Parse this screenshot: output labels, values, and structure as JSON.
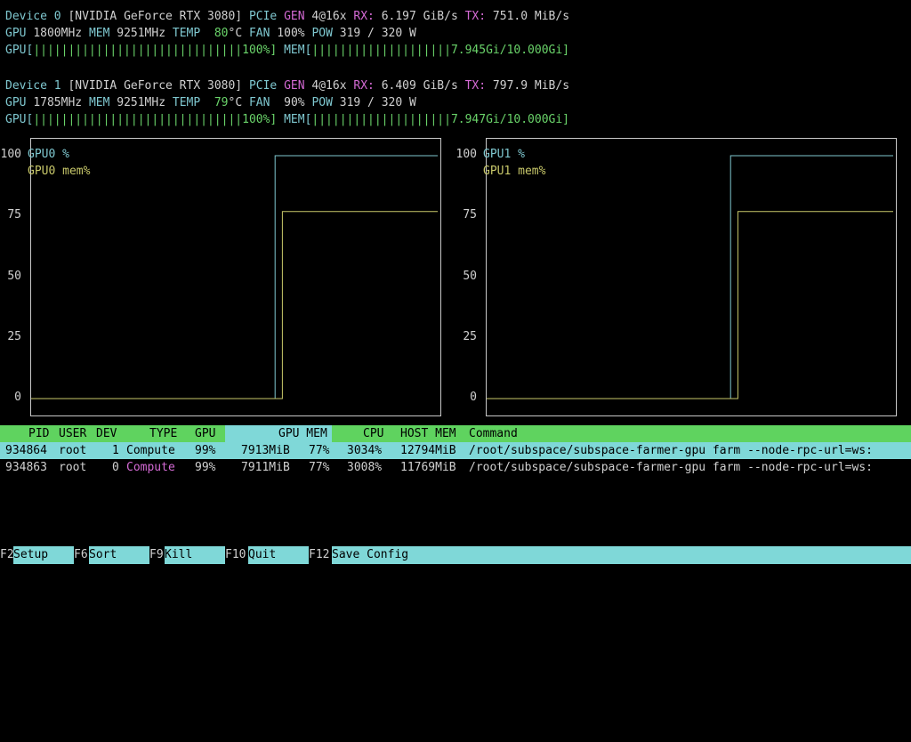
{
  "devices": [
    {
      "line1": {
        "device_label": "Device 0",
        "name": "[NVIDIA GeForce RTX 3080]",
        "pcie_label": "PCIe",
        "gen_label": "GEN",
        "gen_value": "4@16x",
        "rx_label": "RX:",
        "rx_value": "6.197 GiB/s",
        "tx_label": "TX:",
        "tx_value": "751.0 MiB/s"
      },
      "line2": {
        "gpu_label": "GPU",
        "gpu_clock": "1800MHz",
        "mem_label": "MEM",
        "mem_clock": "9251MHz",
        "temp_label": "TEMP",
        "temp_value": "80",
        "temp_unit": "°C",
        "fan_label": "FAN",
        "fan_value": "100%",
        "pow_label": "POW",
        "pow_value": "319 / 320 W"
      },
      "line3": {
        "gpu_bar_label": "GPU[",
        "gpu_bar_fill": "||||||||||||||||||||||||||||||",
        "gpu_bar_value": "100%]",
        "mem_bar_label": "MEM[",
        "mem_bar_fill": "||||||||||||||||||||",
        "mem_bar_value": "7.945Gi/10.000Gi]"
      }
    },
    {
      "line1": {
        "device_label": "Device 1",
        "name": "[NVIDIA GeForce RTX 3080]",
        "pcie_label": "PCIe",
        "gen_label": "GEN",
        "gen_value": "4@16x",
        "rx_label": "RX:",
        "rx_value": "6.409 GiB/s",
        "tx_label": "TX:",
        "tx_value": "797.9 MiB/s"
      },
      "line2": {
        "gpu_label": "GPU",
        "gpu_clock": "1785MHz",
        "mem_label": "MEM",
        "mem_clock": "9251MHz",
        "temp_label": "TEMP",
        "temp_value": "79",
        "temp_unit": "°C",
        "fan_label": "FAN",
        "fan_value": " 90%",
        "pow_label": "POW",
        "pow_value": "319 / 320 W"
      },
      "line3": {
        "gpu_bar_label": "GPU[",
        "gpu_bar_fill": "||||||||||||||||||||||||||||||",
        "gpu_bar_value": "100%]",
        "mem_bar_label": "MEM[",
        "mem_bar_fill": "||||||||||||||||||||",
        "mem_bar_value": "7.947Gi/10.000Gi]"
      }
    }
  ],
  "chart_data": [
    {
      "type": "line",
      "yticks": [
        "100",
        "75",
        "50",
        "25",
        "0"
      ],
      "ylim": [
        0,
        100
      ],
      "legend_placement": "top-left",
      "series": [
        {
          "name": "GPU0 %",
          "color": "#7fc8d0",
          "steps": [
            [
              0,
              0
            ],
            [
              0.6,
              0
            ],
            [
              0.6,
              100
            ],
            [
              1,
              100
            ]
          ]
        },
        {
          "name": "GPU0 mem%",
          "color": "#c8c86a",
          "steps": [
            [
              0,
              0
            ],
            [
              0.618,
              0
            ],
            [
              0.618,
              77
            ],
            [
              1,
              77
            ]
          ]
        }
      ]
    },
    {
      "type": "line",
      "yticks": [
        "100",
        "75",
        "50",
        "25",
        "0"
      ],
      "ylim": [
        0,
        100
      ],
      "legend_placement": "top-left",
      "series": [
        {
          "name": "GPU1 %",
          "color": "#7fc8d0",
          "steps": [
            [
              0,
              0
            ],
            [
              0.6,
              0
            ],
            [
              0.6,
              100
            ],
            [
              1,
              100
            ]
          ]
        },
        {
          "name": "GPU1 mem%",
          "color": "#c8c86a",
          "steps": [
            [
              0,
              0
            ],
            [
              0.618,
              0
            ],
            [
              0.618,
              77
            ],
            [
              1,
              77
            ]
          ]
        }
      ]
    }
  ],
  "process_table": {
    "headers": [
      "PID",
      "USER",
      "DEV",
      "TYPE",
      "GPU",
      "GPU MEM",
      "CPU",
      "HOST MEM",
      "Command"
    ],
    "rows": [
      [
        "934864",
        "root",
        "1",
        "Compute",
        "99%",
        "7913MiB",
        "77%",
        "3034%",
        "12794MiB",
        "/root/subspace/subspace-farmer-gpu farm --node-rpc-url=ws:"
      ],
      [
        "934863",
        "root",
        "0",
        "Compute",
        "99%",
        "7911MiB",
        "77%",
        "3008%",
        "11769MiB",
        "/root/subspace/subspace-farmer-gpu farm --node-rpc-url=ws:"
      ]
    ]
  },
  "function_bar": [
    {
      "key": "F2",
      "label": "Setup"
    },
    {
      "key": "F6",
      "label": "Sort"
    },
    {
      "key": "F9",
      "label": "Kill"
    },
    {
      "key": "F10",
      "label": "Quit"
    },
    {
      "key": "F12",
      "label": "Save Config"
    }
  ]
}
